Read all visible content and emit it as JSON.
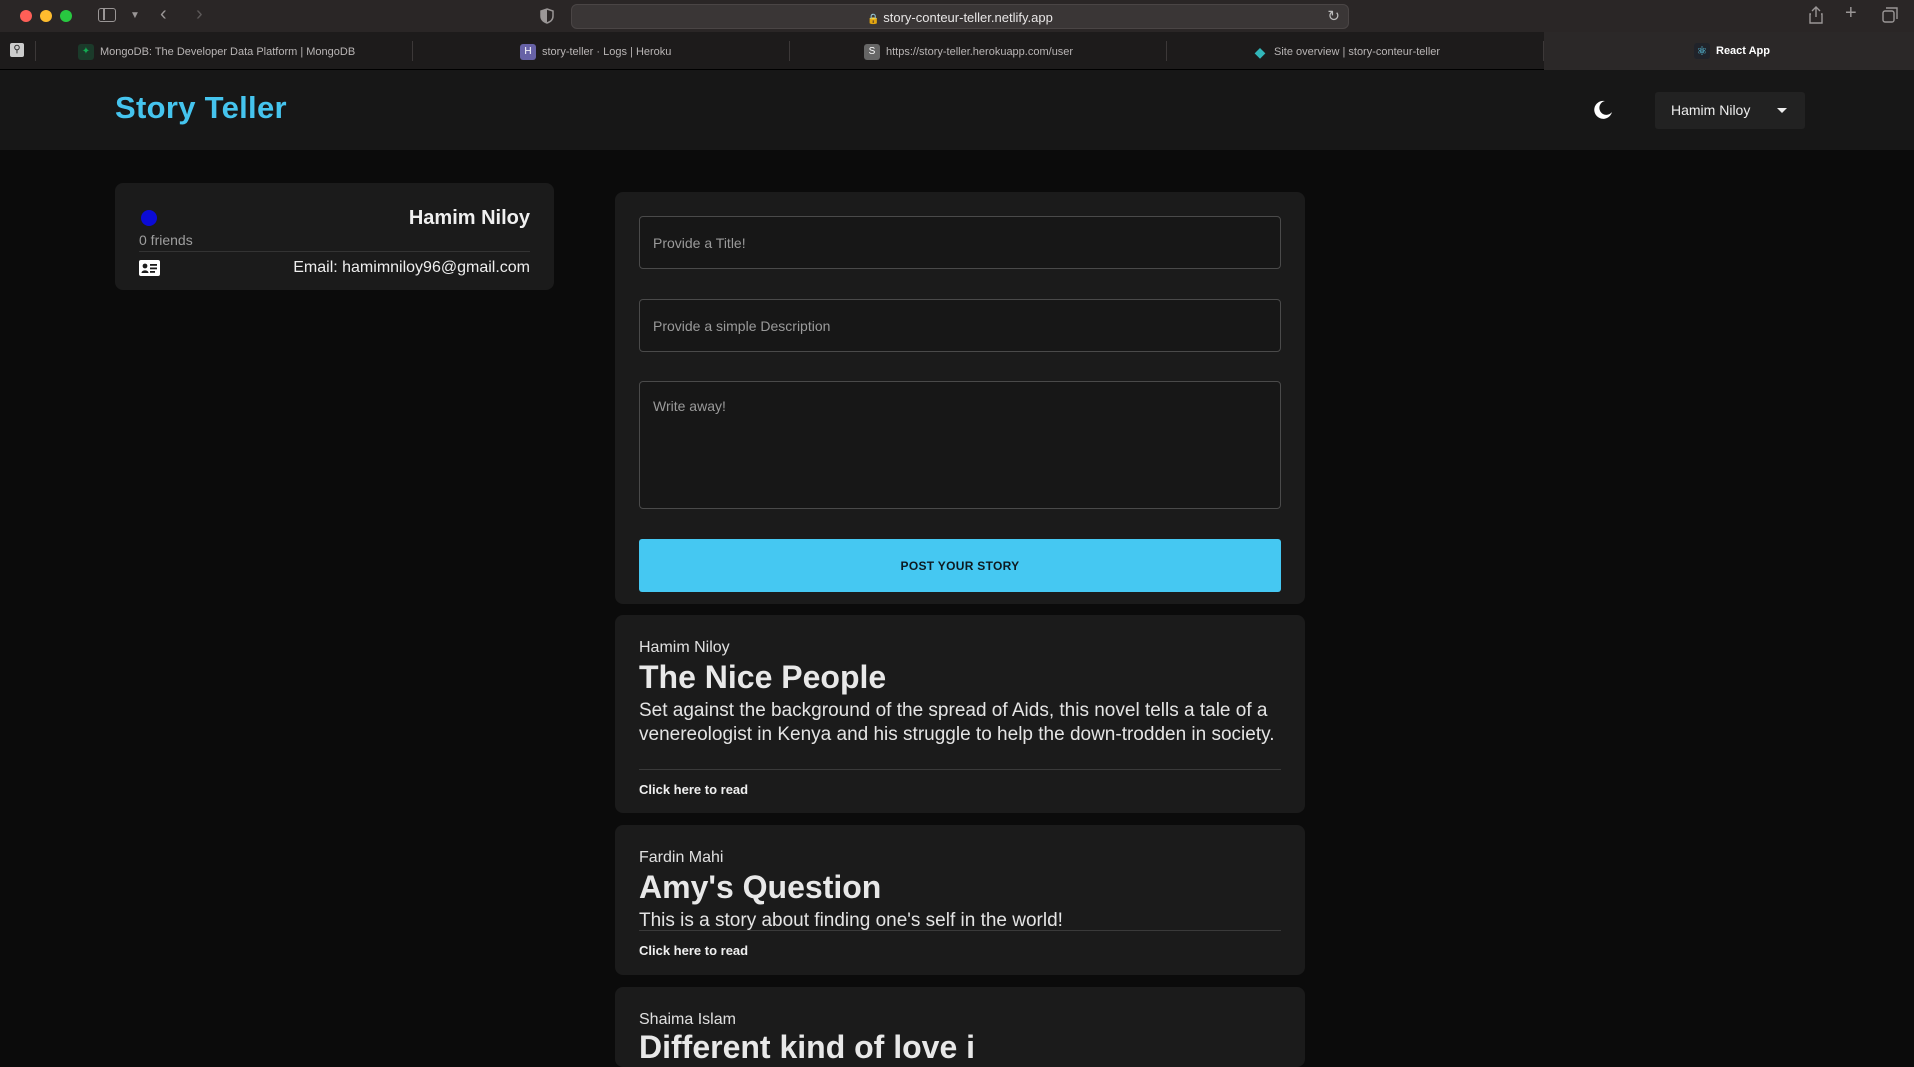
{
  "browser": {
    "url": "story-conteur-teller.netlify.app",
    "tabs": [
      {
        "label": "MongoDB: The Developer Data Platform | MongoDB",
        "icon": "mongodb-leaf-icon"
      },
      {
        "label": "story-teller · Logs | Heroku",
        "icon": "heroku-icon"
      },
      {
        "label": "https://story-teller.herokuapp.com/user",
        "icon": "s-letter-icon"
      },
      {
        "label": "Site overview | story-conteur-teller",
        "icon": "netlify-icon"
      },
      {
        "label": "React App",
        "icon": "react-icon"
      }
    ]
  },
  "header": {
    "brand": "Story Teller",
    "user_menu_label": "Hamim Niloy"
  },
  "profile": {
    "name": "Hamim Niloy",
    "friends": "0 friends",
    "email": "Email: hamimniloy96@gmail.com"
  },
  "post_form": {
    "title_placeholder": "Provide a Title!",
    "description_placeholder": "Provide a simple Description",
    "body_placeholder": "Write away!",
    "submit_label": "POST YOUR STORY"
  },
  "stories": [
    {
      "author": "Hamim Niloy",
      "title": "The Nice People",
      "description": "Set against the background of the spread of Aids, this novel tells a tale of a venereologist in Kenya and his struggle to help the down-trodden in society.",
      "link": "Click here to read"
    },
    {
      "author": "Fardin Mahi",
      "title": "Amy's Question",
      "description": "This is a story about finding one's self in the world!",
      "link": "Click here to read"
    },
    {
      "author": "Shaima Islam",
      "title": "Different kind of love i",
      "description": "",
      "link": ""
    }
  ],
  "colors": {
    "accent": "#45c4ee",
    "button": "#45c8f2",
    "background": "#0b0b0b",
    "card": "#1b1b1b"
  }
}
